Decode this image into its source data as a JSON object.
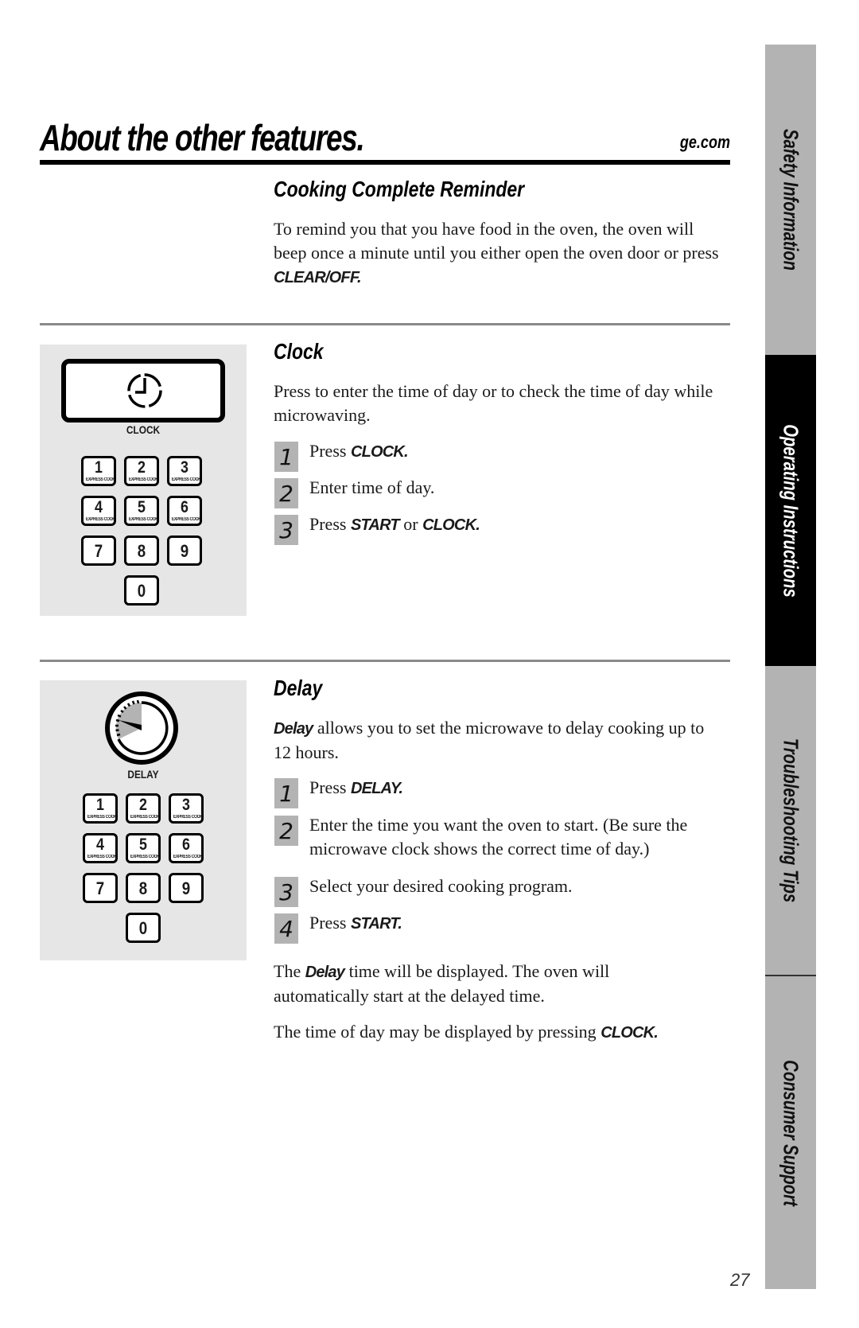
{
  "header": {
    "title": "About the other features.",
    "site": "ge.com"
  },
  "sections": {
    "reminder": {
      "title": "Cooking Complete Reminder",
      "text_pre": "To remind you that you have food in the oven, the oven will beep once a minute until you either open the oven door or press ",
      "text_bold": "CLEAR/OFF."
    },
    "clock": {
      "title": "Clock",
      "description": "Press to enter the time of day or to check the time of day while microwaving.",
      "panel_label": "CLOCK",
      "steps": [
        {
          "num": "1",
          "pre": "Press ",
          "bold": "CLOCK.",
          "post": "",
          "bold2": ""
        },
        {
          "num": "2",
          "pre": "Enter time of day.",
          "bold": "",
          "post": "",
          "bold2": ""
        },
        {
          "num": "3",
          "pre": "Press ",
          "bold": "START",
          "post": " or ",
          "bold2": "CLOCK."
        }
      ]
    },
    "delay": {
      "title": "Delay",
      "desc_bold": "Delay",
      "desc_post": " allows you to set the microwave to delay cooking up to 12 hours.",
      "panel_label": "DELAY",
      "steps": [
        {
          "num": "1",
          "pre": "Press ",
          "bold": "DELAY.",
          "post": "",
          "bold2": ""
        },
        {
          "num": "2",
          "pre": "Enter the time you want the oven to start. (Be sure the microwave clock shows the correct time of day.)",
          "bold": "",
          "post": "",
          "bold2": ""
        },
        {
          "num": "3",
          "pre": "Select your desired cooking program.",
          "bold": "",
          "post": "",
          "bold2": ""
        },
        {
          "num": "4",
          "pre": "Press ",
          "bold": "START.",
          "post": "",
          "bold2": ""
        }
      ],
      "note1_pre": "The ",
      "note1_bold": "Delay",
      "note1_post": " time will be displayed. The oven will automatically start at the delayed time.",
      "note2_pre": "The time of day may be displayed by pressing ",
      "note2_bold": "CLOCK."
    }
  },
  "keypad": {
    "keys": [
      {
        "num": "1",
        "sub": "EXPRESS COOK"
      },
      {
        "num": "2",
        "sub": "EXPRESS COOK"
      },
      {
        "num": "3",
        "sub": "EXPRESS COOK"
      },
      {
        "num": "4",
        "sub": "EXPRESS COOK"
      },
      {
        "num": "5",
        "sub": "EXPRESS COOK"
      },
      {
        "num": "6",
        "sub": "EXPRESS COOK"
      },
      {
        "num": "7",
        "sub": ""
      },
      {
        "num": "8",
        "sub": ""
      },
      {
        "num": "9",
        "sub": ""
      },
      {
        "num": "0",
        "sub": ""
      }
    ]
  },
  "side_tabs": [
    {
      "label": "Safety Information",
      "active": false
    },
    {
      "label": "Operating Instructions",
      "active": true
    },
    {
      "label": "Troubleshooting Tips",
      "active": false
    },
    {
      "label": "Consumer Support",
      "active": false
    }
  ],
  "page_number": "27",
  "colors": {
    "tab_inactive": "#b3b3b3",
    "tab_active": "#000000",
    "panel_bg": "#e6e6e6",
    "step_badge": "#b3b3b3"
  }
}
